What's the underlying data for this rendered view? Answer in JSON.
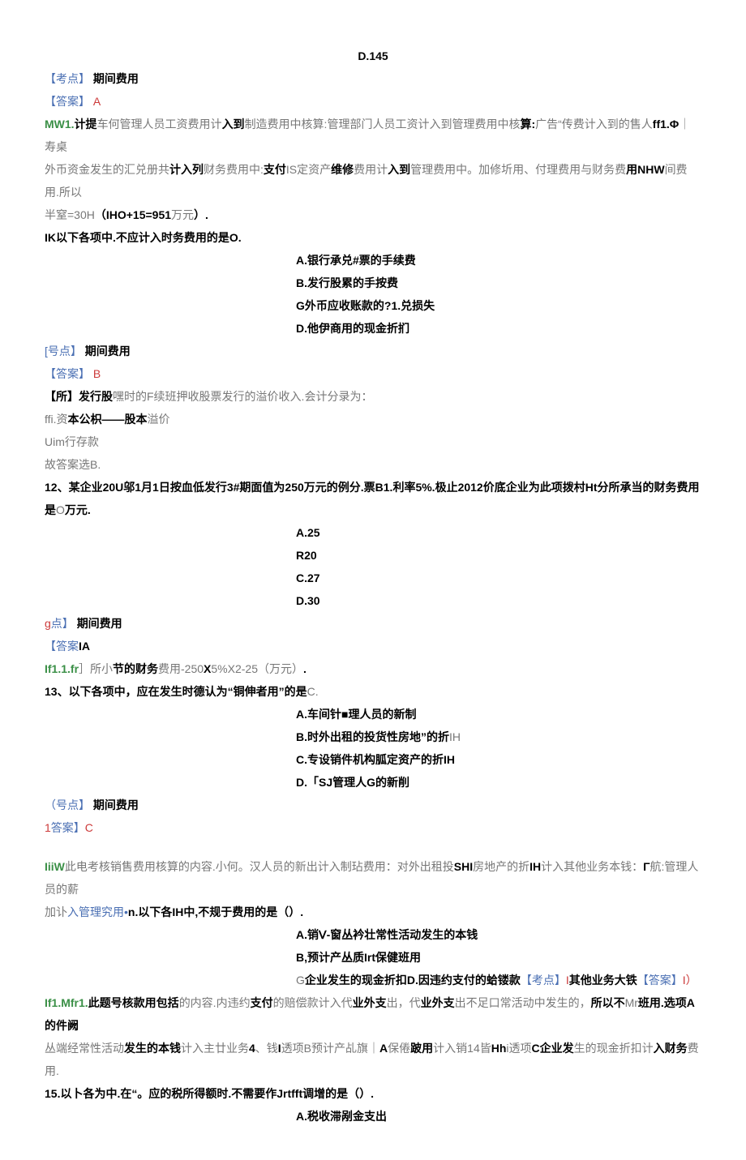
{
  "l1": "D.145",
  "l2a": "【考点】",
  "l2b": "期间费用",
  "l3a": "【答案】",
  "l3b": "A",
  "l4a": "MW1.",
  "l4b": "计提",
  "l4c": "车何管理人员工资费用计",
  "l4d": "入到",
  "l4e": "制造费用中核算:管理部门人员工资计入到管理费用中核",
  "l4f": "算:",
  "l4g": "广告",
  "l4h": "“传费计入到的售人",
  "l4i": "ff1.Φ",
  "l4j": "｜寿桌",
  "l5a": "外币资金发生的汇兑册共",
  "l5b": "计入列",
  "l5c": "财务费用中:",
  "l5d": "支付",
  "l5e": "IS定资产",
  "l5f": "维修",
  "l5g": "费用计",
  "l5h": "入到",
  "l5i": "管理费用中。加修圻用、付理费用与财务费",
  "l5j": "用NHW",
  "l5k": "间费用.所以",
  "l6a": "半窒=30H",
  "l6b": "（IHO+15=951",
  "l6c": "万元",
  "l6d": "）.",
  "l7": "IK以下各项中.不应计入时务费用的是O.",
  "l8": "A.银行承兑#票的手续费",
  "l9": "B.发行股累的手按费",
  "l10": "G外币应收账款的?1.兑损失",
  "l11": "D.他伊商用的现金折扪",
  "l12a": "[号点】",
  "l12b": "期间费用",
  "l13a": "【答案】",
  "l13b": "B",
  "l14a": "【所】",
  "l14b": "发行股",
  "l14c": "嘿时的F续班押收股票发行的溢价收入.会计分录为：",
  "l15a": "ffi.",
  "l15b": "资",
  "l15c": "本公枳——股本",
  "l15d": "溢价",
  "l16": "Uim行存款",
  "l17": "故答案选B.",
  "l18a": "12、某企业20U",
  "l18b": "邬1月1日按血低发行3#期面值为250万元的例分.票B1.利率5%.极止2012价底企业为此项拨村Ht分所承当的财务费用是",
  "l18c": "O",
  "l18d": "万元.",
  "l19": "A.25",
  "l20": "R20",
  "l21": "C.27",
  "l22": "D.30",
  "l23a": "g",
  "l23b": "点】",
  "l23c": "期间费用",
  "l24a": "【答案",
  "l24b": "IA",
  "l25a": "If1.1.fr",
  "l25b": "］所小",
  "l25c": "节的财务",
  "l25d": "费用-250",
  "l25e": "X",
  "l25f": "5%X2-25",
  "l25g": "（万元）",
  "l25h": ".",
  "l26a": "13、以下各项中，应在发生时德认为“铜伸者用”的是",
  "l26b": "C.",
  "l27": "A.车间针■理人员的新制",
  "l28a": "B.时外出租的投货性房地”的折",
  "l28b": "IH",
  "l29": "C.专设销件机构胍定资产的折IH",
  "l30": "D.「SJ管理人G的新削",
  "l31a": "（号点】",
  "l31b": "期间费用",
  "l32a": "1",
  "l32b": "答案】",
  "l32c": "C",
  "l33a": "IiiW",
  "l33b": "此电考核销售费用核算的内容.小何。汉人员的新出计入制玷费用：对外出租投",
  "l33c": "SHI",
  "l33d": "房地产的折",
  "l33e": "IH",
  "l33f": "计入其他业务本钱：",
  "l33g": "Γ",
  "l33h": "航:管理人员的薪",
  "l34a": "加讣",
  "l34b": "入管理究用•",
  "l34c": "n.",
  "l34d": "以下各",
  "l34e": "IH",
  "l34f": "中,不规于费用的是（）.",
  "l35": "A.销Ⅴ-窗丛衿壮常性活动发生的本钱",
  "l36": "B,预计产丛质Irt保健班用",
  "l37a": "G",
  "l37b": "企业发生的现金折扣",
  "l37c": "D.",
  "l37d": "因违约支付的蛤镂款",
  "l37e": "【考点】",
  "l37f": "I",
  "l37g": "其他业务大铁",
  "l37h": "【答案】",
  "l37i": "I）",
  "l38a": "If1.Mfr1.",
  "l38b": "此题号核款用包括",
  "l38c": "的内容.内违约",
  "l38d": "支付",
  "l38e": "的赔偿款计入代",
  "l38f": "业外支",
  "l38g": "出，代",
  "l38h": "业外支",
  "l38i": "出不足口常活动中发生的，",
  "l38j": "所以不",
  "l38k": "Mr",
  "l38l": "班用.选项A的件阙",
  "l39a": "丛端经常性活动",
  "l39b": "发生的本钱",
  "l39c": "计入主廿业务",
  "l39d": "4",
  "l39e": "、钱",
  "l39f": "I",
  "l39g": "透项B预计产乩旗｜",
  "l39h": "A",
  "l39i": "保倦",
  "l39j": "跛用",
  "l39k": "计入销14皆",
  "l39l": "Hh",
  "l39m": "i透项",
  "l39n": "C",
  "l39o": "企业发",
  "l39p": "生的现金折扣计",
  "l39q": "入财务",
  "l39r": "费用.",
  "l40": "15.以卜各为中.在“。应的税所得额时.不需要作Jrtfft调增的是（）.",
  "l41": "A.税收滞剐金支出"
}
